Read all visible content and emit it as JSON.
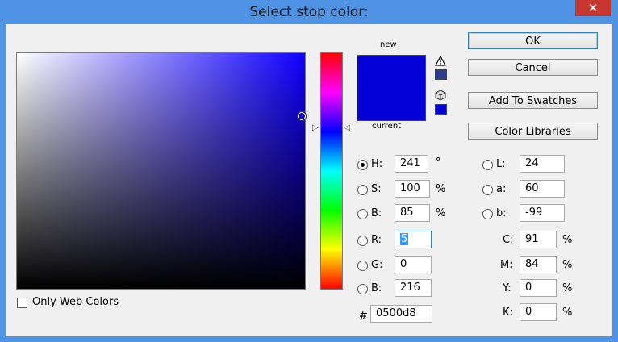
{
  "window": {
    "title": "Select stop color:",
    "close_glyph": "✕"
  },
  "preview": {
    "new_label": "new",
    "current_label": "current",
    "new_color": "#0500d8",
    "current_color": "#0500d8"
  },
  "buttons": {
    "ok": "OK",
    "cancel": "Cancel",
    "add_to_swatches": "Add To Swatches",
    "color_libraries": "Color Libraries"
  },
  "hsb": {
    "h": {
      "label": "H:",
      "value": "241",
      "unit": "°",
      "selected": true
    },
    "s": {
      "label": "S:",
      "value": "100",
      "unit": "%"
    },
    "b": {
      "label": "B:",
      "value": "85",
      "unit": "%"
    }
  },
  "rgb": {
    "r": {
      "label": "R:",
      "value": "5"
    },
    "g": {
      "label": "G:",
      "value": "0"
    },
    "b": {
      "label": "B:",
      "value": "216"
    }
  },
  "hex": {
    "label": "#",
    "value": "0500d8"
  },
  "lab": {
    "l": {
      "label": "L:",
      "value": "24"
    },
    "a": {
      "label": "a:",
      "value": "60"
    },
    "b": {
      "label": "b:",
      "value": "-99"
    }
  },
  "cmyk": {
    "c": {
      "label": "C:",
      "value": "91",
      "unit": "%"
    },
    "m": {
      "label": "M:",
      "value": "84",
      "unit": "%"
    },
    "y": {
      "label": "Y:",
      "value": "0",
      "unit": "%"
    },
    "k": {
      "label": "K:",
      "value": "0",
      "unit": "%"
    }
  },
  "web_colors": {
    "label": "Only Web Colors",
    "checked": false
  },
  "icons": {
    "gamut_warning": "warning-triangle-icon",
    "web_safe": "cube-icon"
  },
  "colors": {
    "gamut_swatch": "#2c3c8c",
    "websafe_swatch": "#0000cc",
    "accent": "#3c7fb1"
  }
}
